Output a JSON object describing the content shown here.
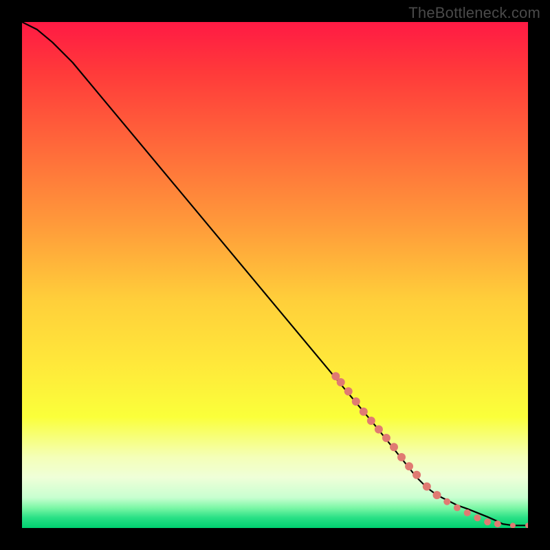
{
  "watermark": "TheBottleneck.com",
  "chart_data": {
    "type": "line",
    "title": "",
    "xlabel": "",
    "ylabel": "",
    "xlim": [
      0,
      100
    ],
    "ylim": [
      0,
      100
    ],
    "grid": false,
    "legend": false,
    "series": [
      {
        "name": "curve",
        "x": [
          0,
          3,
          6,
          10,
          15,
          20,
          30,
          40,
          50,
          60,
          70,
          78,
          80,
          82,
          84,
          86,
          88,
          90,
          92,
          94,
          95,
          97,
          100
        ],
        "y": [
          100,
          98.5,
          96,
          92,
          86,
          80,
          68,
          56,
          44,
          32,
          20,
          10,
          8,
          6.5,
          5.5,
          4.5,
          3.8,
          3.0,
          2.2,
          1.3,
          0.8,
          0.5,
          0.5
        ]
      }
    ],
    "markers": {
      "name": "highlighted-points",
      "color": "#e07a72",
      "points": [
        {
          "x": 62,
          "y": 30,
          "r": 6
        },
        {
          "x": 63,
          "y": 28.8,
          "r": 6
        },
        {
          "x": 64.5,
          "y": 27,
          "r": 6
        },
        {
          "x": 66,
          "y": 25,
          "r": 6
        },
        {
          "x": 67.5,
          "y": 23,
          "r": 6
        },
        {
          "x": 69,
          "y": 21.2,
          "r": 6
        },
        {
          "x": 70.5,
          "y": 19.5,
          "r": 6
        },
        {
          "x": 72,
          "y": 17.8,
          "r": 6
        },
        {
          "x": 73.5,
          "y": 16,
          "r": 6
        },
        {
          "x": 75,
          "y": 14,
          "r": 6
        },
        {
          "x": 76.5,
          "y": 12.2,
          "r": 6
        },
        {
          "x": 78,
          "y": 10.5,
          "r": 6
        },
        {
          "x": 80,
          "y": 8.2,
          "r": 6
        },
        {
          "x": 82,
          "y": 6.5,
          "r": 6
        },
        {
          "x": 84,
          "y": 5.2,
          "r": 5
        },
        {
          "x": 86,
          "y": 4.0,
          "r": 5
        },
        {
          "x": 88,
          "y": 3.0,
          "r": 5
        },
        {
          "x": 90,
          "y": 2.0,
          "r": 5
        },
        {
          "x": 92,
          "y": 1.2,
          "r": 5
        },
        {
          "x": 94,
          "y": 0.8,
          "r": 5
        },
        {
          "x": 97,
          "y": 0.5,
          "r": 4
        },
        {
          "x": 100,
          "y": 0.5,
          "r": 4
        }
      ]
    }
  }
}
